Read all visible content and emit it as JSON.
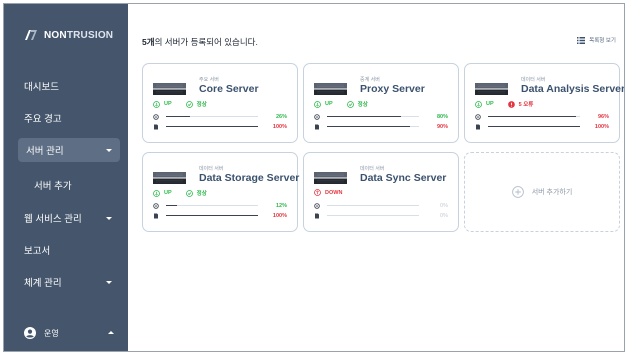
{
  "brand": {
    "logo_text": "NONTRUSION",
    "logo_prefix": "NON",
    "logo_suffix": "TRUSION"
  },
  "sidebar": {
    "items": [
      {
        "label": "대시보드"
      },
      {
        "label": "주요 경고"
      },
      {
        "label": "서버 관리"
      },
      {
        "label": "서버 추가"
      },
      {
        "label": "웹 서비스 관리"
      },
      {
        "label": "보고서"
      },
      {
        "label": "체계 관리"
      }
    ],
    "user": {
      "label": "운영"
    }
  },
  "header": {
    "count_bold": "5개",
    "count_rest": "의 서버가 등록되어 있습니다.",
    "view_toggle": "목록형 보기"
  },
  "servers": [
    {
      "type": "주요 서버",
      "name": "Core Server",
      "status": "UP",
      "health": "정상",
      "health_state": "ok",
      "cpu": 26,
      "cpu_label": "26%",
      "disk": 100,
      "disk_label": "100%"
    },
    {
      "type": "중계 서버",
      "name": "Proxy Server",
      "status": "UP",
      "health": "정상",
      "health_state": "ok",
      "cpu": 80,
      "cpu_label": "80%",
      "disk": 90,
      "disk_label": "90%"
    },
    {
      "type": "데이터 서버",
      "name": "Data Analysis Server",
      "status": "UP",
      "health": "5 오류",
      "health_state": "error",
      "cpu": 96,
      "cpu_label": "96%",
      "disk": 100,
      "disk_label": "100%"
    },
    {
      "type": "데이터 서버",
      "name": "Data Storage Server",
      "status": "UP",
      "health": "정상",
      "health_state": "ok",
      "cpu": 12,
      "cpu_label": "12%",
      "disk": 100,
      "disk_label": "100%"
    },
    {
      "type": "데이터 서버",
      "name": "Data Sync Server",
      "status": "DOWN",
      "health": "",
      "health_state": "none",
      "cpu": 0,
      "cpu_label": "0%",
      "disk": 0,
      "disk_label": "0%"
    }
  ],
  "add_server": {
    "label": "서버 추가하기"
  },
  "colors": {
    "sidebar": "#45566c",
    "active": "#5d6e85",
    "up": "#2db84d",
    "down": "#e5353f",
    "card_border": "#c7d2de"
  }
}
